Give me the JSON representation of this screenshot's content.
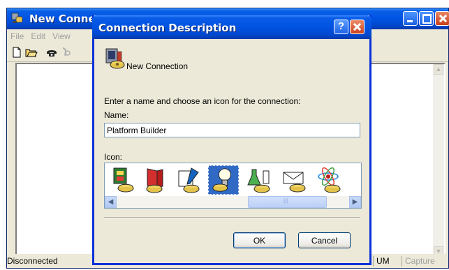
{
  "background_window": {
    "title": "New Connec",
    "menu": [
      "File",
      "Edit",
      "View"
    ],
    "status": {
      "main": "Disconnected",
      "num": "UM",
      "cap": "Capture"
    }
  },
  "dialog": {
    "title": "Connection Description",
    "help_label": "?",
    "heading": "New Connection",
    "prompt": "Enter a name and choose an icon for the connection:",
    "name_label": "Name:",
    "name_value": "Platform Builder",
    "icon_label": "Icon:",
    "selected_icon_index": 4,
    "ok_label": "OK",
    "cancel_label": "Cancel"
  },
  "colors": {
    "xp_title_blue": "#0054e3",
    "selection": "#316ac5",
    "close_red": "#c9431e",
    "dialog_face": "#ece9d8"
  }
}
